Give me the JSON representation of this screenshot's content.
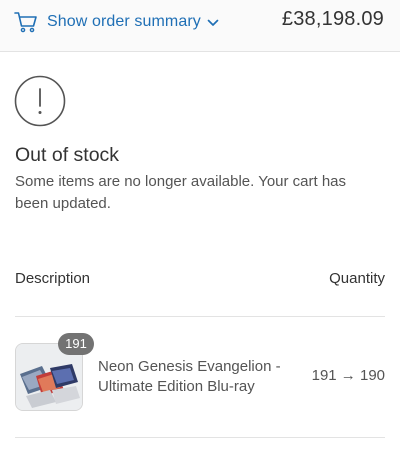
{
  "header": {
    "summary_toggle_label": "Show order summary",
    "total": "£38,198.09",
    "icons": {
      "cart": "cart-icon",
      "toggle": "chevron-down-icon"
    },
    "accent_color": "#1f6fb5"
  },
  "notice": {
    "icon": "exclamation-circle-icon",
    "title": "Out of stock",
    "message": "Some items are no longer available. Your cart has been updated."
  },
  "table": {
    "headers": {
      "description": "Description",
      "quantity": "Quantity"
    },
    "rows": [
      {
        "name": "Neon Genesis Evangelion - Ultimate Edition Blu-ray",
        "badge": "191",
        "quantity_change": "191 → 190"
      }
    ]
  }
}
